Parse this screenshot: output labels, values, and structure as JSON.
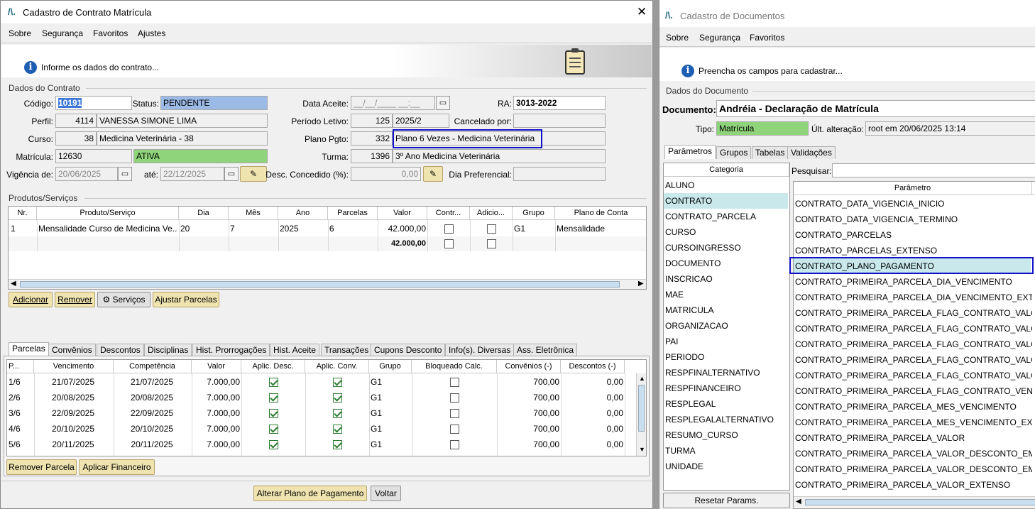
{
  "left": {
    "title": "Cadastro de Contrato Matrícula",
    "menu": [
      "Sobre",
      "Segurança",
      "Favoritos",
      "Ajustes"
    ],
    "info": "Informe os dados do contrato...",
    "section_contract": "Dados do Contrato",
    "codigo_label": "Código:",
    "codigo": "10191",
    "status_label": "Status:",
    "status": "PENDENTE",
    "data_aceite_label": "Data Aceite:",
    "data_aceite": "__/__/____ __:__",
    "ra_label": "RA:",
    "ra": "3013-2022",
    "perfil_label": "Perfil:",
    "perfil_id": "4114",
    "perfil": "VANESSA SIMONE LIMA",
    "periodo_label": "Período Letivo:",
    "periodo_id": "125",
    "periodo": "2025/2",
    "cancelado_label": "Cancelado por:",
    "curso_label": "Curso:",
    "curso_id": "38",
    "curso": "Medicina Veterinária - 38",
    "plano_label": "Plano Pgto:",
    "plano_id": "332",
    "plano": "Plano 6 Vezes - Medicina Veterinária",
    "matricula_label": "Matrícula:",
    "matricula": "12630",
    "matricula_status": "ATIVA",
    "turma_label": "Turma:",
    "turma_id": "1396",
    "turma": "3º Ano Medicina Veterinária",
    "vigencia_label": "Vigência de:",
    "vigencia_de": "20/06/2025",
    "ate_label": "até:",
    "vigencia_ate": "22/12/2025",
    "desc_label": "Desc. Concedido (%):",
    "desc_value": "0,00",
    "dia_pref_label": "Dia Preferencial:",
    "section_products": "Produtos/Serviços",
    "products_headers": [
      "Nr.",
      "Produto/Serviço",
      "Dia",
      "Mês",
      "Ano",
      "Parcelas",
      "Valor",
      "Contr...",
      "Adicio...",
      "Grupo",
      "Plano de Conta"
    ],
    "product_row": {
      "nr": "1",
      "produto": "Mensalidade Curso de Medicina Ve...",
      "dia": "20",
      "mes": "7",
      "ano": "2025",
      "parcelas": "6",
      "valor": "42.000,00",
      "grupo": "G1",
      "plano": "Mensalidade"
    },
    "products_total": "42.000,00",
    "btn_adicionar": "Adicionar",
    "btn_remover": "Remover",
    "btn_servicos": "Serviços",
    "btn_ajustar": "Ajustar Parcelas",
    "tabs": [
      "Parcelas",
      "Convênios",
      "Descontos",
      "Disciplinas",
      "Hist. Prorrogações",
      "Hist. Aceite",
      "Transações",
      "Cupons Desconto",
      "Info(s). Diversas",
      "Ass. Eletrônica"
    ],
    "parcelas_headers": [
      "P...",
      "Vencimento",
      "Competência",
      "Valor",
      "Aplic. Desc.",
      "Aplic. Conv.",
      "Grupo",
      "Bloqueado Calc.",
      "Convênios (-)",
      "Descontos (-)"
    ],
    "parcelas": [
      {
        "p": "1/6",
        "venc": "21/07/2025",
        "comp": "21/07/2025",
        "valor": "7.000,00",
        "grupo": "G1",
        "conv": "700,00",
        "desc": "0,00"
      },
      {
        "p": "2/6",
        "venc": "20/08/2025",
        "comp": "20/08/2025",
        "valor": "7.000,00",
        "grupo": "G1",
        "conv": "700,00",
        "desc": "0,00"
      },
      {
        "p": "3/6",
        "venc": "22/09/2025",
        "comp": "22/09/2025",
        "valor": "7.000,00",
        "grupo": "G1",
        "conv": "700,00",
        "desc": "0,00"
      },
      {
        "p": "4/6",
        "venc": "20/10/2025",
        "comp": "20/10/2025",
        "valor": "7.000,00",
        "grupo": "G1",
        "conv": "700,00",
        "desc": "0,00"
      },
      {
        "p": "5/6",
        "venc": "20/11/2025",
        "comp": "20/11/2025",
        "valor": "7.000,00",
        "grupo": "G1",
        "conv": "700,00",
        "desc": "0,00"
      }
    ],
    "btn_remover_parcela": "Remover Parcela",
    "btn_aplicar": "Aplicar Financeiro",
    "btn_alterar": "Alterar Plano de Pagamento",
    "btn_voltar": "Voltar"
  },
  "right": {
    "title": "Cadastro de Documentos",
    "menu": [
      "Sobre",
      "Segurança",
      "Favoritos"
    ],
    "info": "Preencha os campos para cadastrar...",
    "section": "Dados do Documento",
    "documento_label": "Documento:",
    "documento": "Andréia - Declaração de Matrícula",
    "tipo_label": "Tipo:",
    "tipo": "Matrícula",
    "ult_label": "Últ. alteração:",
    "ult": "root em 20/06/2025 13:14",
    "tabs": [
      "Parâmetros",
      "Grupos",
      "Tabelas",
      "Validações"
    ],
    "categoria_header": "Categoria",
    "categorias": [
      "ALUNO",
      "CONTRATO",
      "CONTRATO_PARCELA",
      "CURSO",
      "CURSOINGRESSO",
      "DOCUMENTO",
      "INSCRICAO",
      "MAE",
      "MATRICULA",
      "ORGANIZACAO",
      "PAI",
      "PERIODO",
      "RESPFINALTERNATIVO",
      "RESPFINANCEIRO",
      "RESPLEGAL",
      "RESPLEGALALTERNATIVO",
      "RESUMO_CURSO",
      "TURMA",
      "UNIDADE"
    ],
    "pesquisar_label": "Pesquisar:",
    "parametro_header": "Parâmetro",
    "parametros": [
      "CONTRATO_DATA_VIGENCIA_INICIO",
      "CONTRATO_DATA_VIGENCIA_TERMINO",
      "CONTRATO_PARCELAS",
      "CONTRATO_PARCELAS_EXTENSO",
      "CONTRATO_PLANO_PAGAMENTO",
      "CONTRATO_PRIMEIRA_PARCELA_DIA_VENCIMENTO",
      "CONTRATO_PRIMEIRA_PARCELA_DIA_VENCIMENTO_EXTENSO",
      "CONTRATO_PRIMEIRA_PARCELA_FLAG_CONTRATO_VALOR",
      "CONTRATO_PRIMEIRA_PARCELA_FLAG_CONTRATO_VALOR_...",
      "CONTRATO_PRIMEIRA_PARCELA_FLAG_CONTRATO_VALOR_...",
      "CONTRATO_PRIMEIRA_PARCELA_FLAG_CONTRATO_VALOR_...",
      "CONTRATO_PRIMEIRA_PARCELA_FLAG_CONTRATO_VALOR_...",
      "CONTRATO_PRIMEIRA_PARCELA_FLAG_CONTRATO_VENCIM...",
      "CONTRATO_PRIMEIRA_PARCELA_MES_VENCIMENTO",
      "CONTRATO_PRIMEIRA_PARCELA_MES_VENCIMENTO_EXTEN...",
      "CONTRATO_PRIMEIRA_PARCELA_VALOR",
      "CONTRATO_PRIMEIRA_PARCELA_VALOR_DESCONTO_EM_P...",
      "CONTRATO_PRIMEIRA_PARCELA_VALOR_DESCONTO_EM_P...",
      "CONTRATO_PRIMEIRA_PARCELA_VALOR_EXTENSO"
    ],
    "btn_resetar": "Resetar Params."
  },
  "colors": {
    "status_blue": "#9bbbe6",
    "green": "#8fd47a",
    "selection": "#c8e8ec",
    "highlight_border": "#1010c8"
  }
}
